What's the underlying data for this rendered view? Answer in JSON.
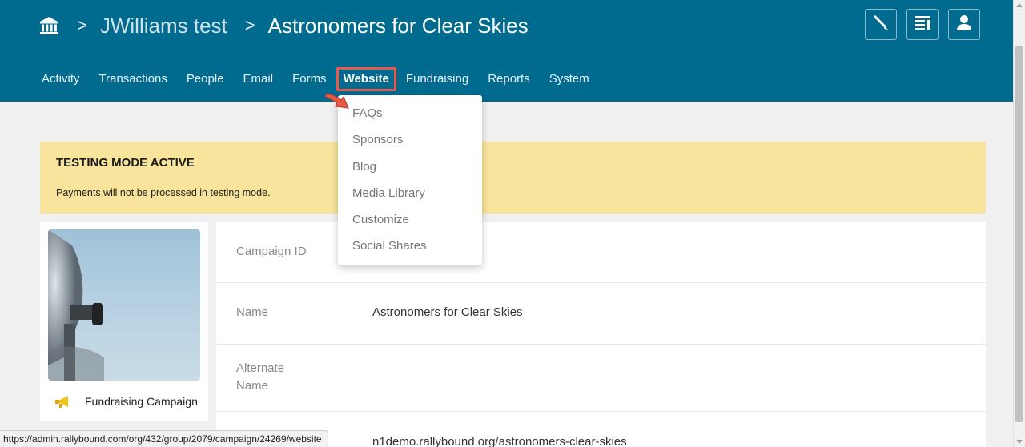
{
  "breadcrumb": {
    "home_icon": "bank-icon",
    "separator": ">",
    "organization": "JWilliams test",
    "campaign": "Astronomers for Clear Skies"
  },
  "header_buttons": [
    {
      "name": "pen-icon"
    },
    {
      "name": "layout-icon"
    },
    {
      "name": "user-icon"
    }
  ],
  "nav": {
    "items": [
      "Activity",
      "Transactions",
      "People",
      "Email",
      "Forms",
      "Website",
      "Fundraising",
      "Reports",
      "System"
    ],
    "active": "Website"
  },
  "website_menu": {
    "items": [
      "FAQs",
      "Sponsors",
      "Blog",
      "Media Library",
      "Customize",
      "Social Shares"
    ]
  },
  "banner": {
    "title": "TESTING MODE ACTIVE",
    "text": "Payments will not be processed in testing mode."
  },
  "campaign_card": {
    "type_label": "Fundraising Campaign",
    "type_icon": "megaphone-icon"
  },
  "details": {
    "campaign_id_label": "Campaign ID",
    "name_label": "Name",
    "name_value": "Astronomers for Clear Skies",
    "alternate_name_label": "Alternate Name",
    "url_value": "n1demo.rallybound.org/astronomers-clear-skies"
  },
  "status_bar": {
    "url": "https://admin.rallybound.com/org/432/group/2079/campaign/24269/website"
  },
  "colors": {
    "header": "#006a8f",
    "highlight": "#e45a4f",
    "banner": "#f8e49c"
  }
}
